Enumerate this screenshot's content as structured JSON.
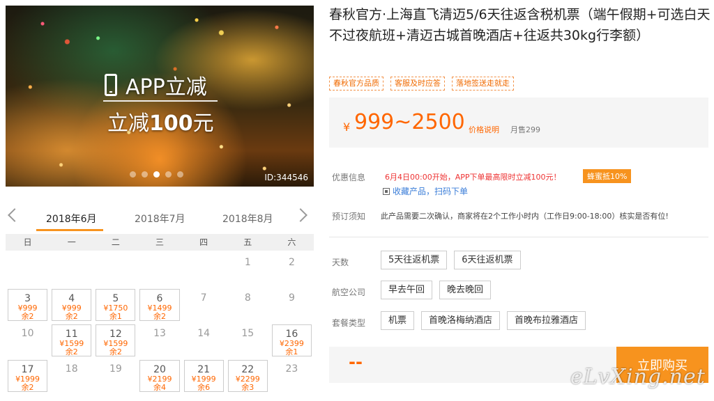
{
  "hero": {
    "app_text": "APP立减",
    "discount_prefix": "立减",
    "discount_amount": "100",
    "discount_suffix": "元",
    "id_label": "ID:344546"
  },
  "title": "春秋官方·上海直飞清迈5/6天往返含税机票（端午假期+可选白天不过夜航班+清迈古城首晚酒店+往返共30kg行李额）",
  "tags": [
    "春秋官方品质",
    "客服及时应答",
    "落地签送走就走"
  ],
  "price": {
    "currency": "¥",
    "range": "999~2500",
    "note": "价格说明",
    "sold": "月售299"
  },
  "promo": {
    "label": "优惠信息",
    "text": "6月4日00:00开始，APP下单最高限时立减100元！",
    "badge": "蜂蜜抵10%",
    "fav": "收藏产品，扫码下单"
  },
  "notice": {
    "label": "预订须知",
    "text": "此产品需要二次确认，商家将在2个工作小时内（工作日9:00-18:00）核实是否有位!"
  },
  "options": {
    "days_label": "天数",
    "days": [
      "5天往返机票",
      "6天往返机票"
    ],
    "airline_label": "航空公司",
    "airline": [
      "早去午回",
      "晚去晚回"
    ],
    "package_label": "套餐类型",
    "package": [
      "机票",
      "首晚洛梅纳酒店",
      "首晚布拉雅酒店"
    ]
  },
  "buy": {
    "placeholder": "--",
    "button": "立即购买"
  },
  "watermark": "eLvXing.net",
  "calendar": {
    "months": [
      "2018年6月",
      "2018年7月",
      "2018年8月"
    ],
    "weekdays": [
      "日",
      "一",
      "二",
      "三",
      "四",
      "五",
      "六"
    ],
    "rows": [
      [
        {
          "d": ""
        },
        {
          "d": ""
        },
        {
          "d": ""
        },
        {
          "d": ""
        },
        {
          "d": ""
        },
        {
          "d": "1"
        },
        {
          "d": "2"
        }
      ],
      [
        {
          "d": "3",
          "p": "¥999",
          "r": "余2"
        },
        {
          "d": "4",
          "p": "¥999",
          "r": "余2"
        },
        {
          "d": "5",
          "p": "¥1750",
          "r": "余1"
        },
        {
          "d": "6",
          "p": "¥1499",
          "r": "余2"
        },
        {
          "d": "7"
        },
        {
          "d": "8"
        },
        {
          "d": "9"
        }
      ],
      [
        {
          "d": "10"
        },
        {
          "d": "11",
          "p": "¥1599",
          "r": "余2"
        },
        {
          "d": "12",
          "p": "¥1599",
          "r": "余2"
        },
        {
          "d": "13"
        },
        {
          "d": "14"
        },
        {
          "d": "15"
        },
        {
          "d": "16",
          "p": "¥2399",
          "r": "余1"
        }
      ],
      [
        {
          "d": "17",
          "p": "¥1999",
          "r": "余2"
        },
        {
          "d": "18"
        },
        {
          "d": "19"
        },
        {
          "d": "20",
          "p": "¥2199",
          "r": "余4"
        },
        {
          "d": "21",
          "p": "¥1999",
          "r": "余6"
        },
        {
          "d": "22",
          "p": "¥2299",
          "r": "余3"
        },
        {
          "d": "23"
        }
      ]
    ]
  }
}
